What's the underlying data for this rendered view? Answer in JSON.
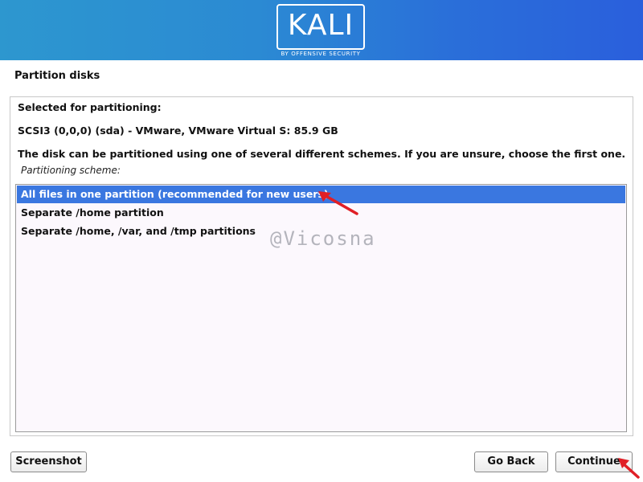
{
  "header": {
    "logo_text": "KALI",
    "logo_subtitle": "BY OFFENSIVE SECURITY",
    "background_color": "#2b7fd6"
  },
  "step_title": "Partition disks",
  "content": {
    "selected_heading": "Selected for partitioning:",
    "disk": "SCSI3 (0,0,0) (sda) - VMware, VMware Virtual S: 85.9 GB",
    "description": "The disk can be partitioned using one of several different schemes. If you are unsure, choose the first one.",
    "list_label": "Partitioning scheme:",
    "options": [
      {
        "label": "All files in one partition (recommended for new users)",
        "selected": true
      },
      {
        "label": "Separate /home partition",
        "selected": false
      },
      {
        "label": "Separate /home, /var, and /tmp partitions",
        "selected": false
      }
    ],
    "selection_color": "#3a77e0"
  },
  "watermark": "@Vicosna",
  "buttons": {
    "screenshot": "Screenshot",
    "go_back": "Go Back",
    "continue": "Continue"
  },
  "annotation_color": "#e01f26"
}
